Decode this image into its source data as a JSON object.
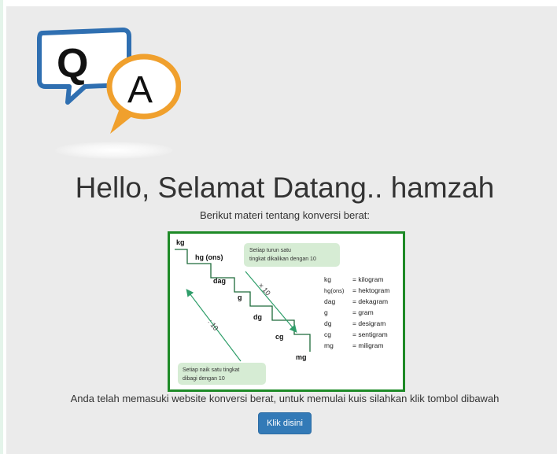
{
  "logo": {
    "q_letter": "Q",
    "a_letter": "A",
    "colors": {
      "q_bubble": "#2f6fb1",
      "a_bubble": "#f0a02d"
    }
  },
  "greeting": "Hello, Selamat Datang.. hamzah",
  "intro": "Berikut materi tentang konversi berat:",
  "diagram": {
    "steps": [
      "kg",
      "hg (ons)",
      "dag",
      "g",
      "dg",
      "cg",
      "mg"
    ],
    "down_note_line1": "Setiap turun satu",
    "down_note_line2": "tingkat dikalikan dengan 10",
    "down_label": "× 10",
    "up_label": ": 10",
    "up_note_line1": "Setiap naik satu tingkat",
    "up_note_line2": "dibagi dengan 10",
    "legend": [
      {
        "abbr": "kg",
        "name": "= kilogram"
      },
      {
        "abbr": "hg(ons)",
        "name": "= hektogram"
      },
      {
        "abbr": "dag",
        "name": "= dekagram"
      },
      {
        "abbr": "g",
        "name": "= gram"
      },
      {
        "abbr": "dg",
        "name": "= desigram"
      },
      {
        "abbr": "cg",
        "name": "= sentigram"
      },
      {
        "abbr": "mg",
        "name": "= miligram"
      }
    ],
    "colors": {
      "border": "#1e8a27",
      "arrow": "#2f9e6a",
      "note_bg": "#d6ecd4"
    }
  },
  "description": "Anda telah memasuki website konversi berat, untuk memulai kuis silahkan klik tombol dibawah",
  "start_button": "Klik disini"
}
